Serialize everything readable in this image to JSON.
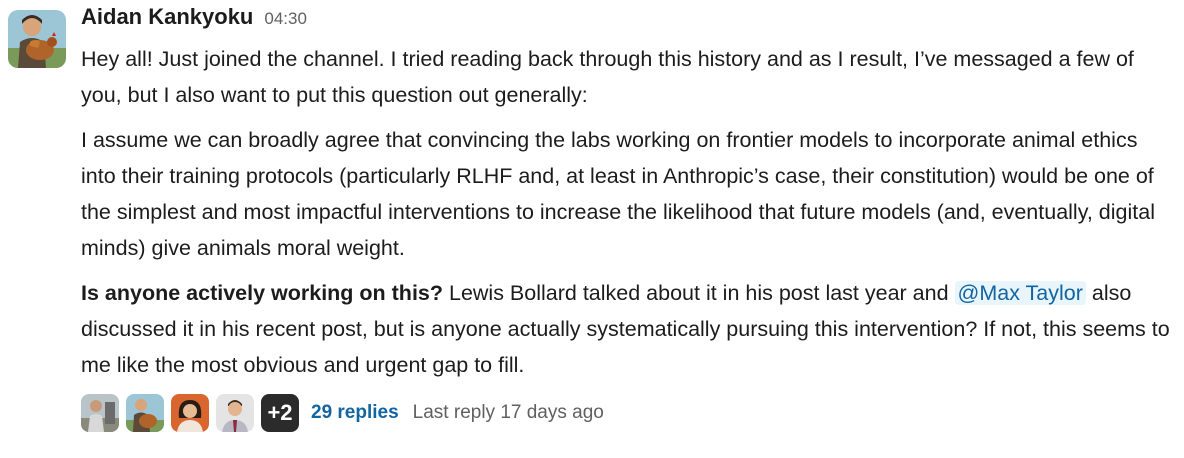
{
  "message": {
    "sender": "Aidan Kankyoku",
    "timestamp": "04:30",
    "p1": "Hey all! Just joined the channel. I tried reading back through this history and as I result, I’ve messaged a few of you, but I also want to put this question out generally:",
    "p2": "I assume we can broadly agree that convincing the labs working on frontier models to incorporate animal ethics into their training protocols (particularly RLHF and, at least in Anthropic’s case, their constitution) would be one of the simplest and most impactful interventions to increase the likelihood that future models (and, eventually, digital minds) give animals moral weight.",
    "p3": {
      "bold": "Is anyone actively working on this?",
      "text1": " Lewis Bollard talked about it in his post last year and ",
      "mention": "@Max Taylor",
      "text2": " also discussed it in his recent post, but is anyone actually systematically pursuing this intervention? If not, this seems to me like the most obvious and urgent gap to fill."
    }
  },
  "thread": {
    "more_count": "+2",
    "replies": "29 replies",
    "last_reply": "Last reply 17 days ago"
  },
  "icons": {
    "sender_avatar": "user-avatar-icon",
    "participant_avatars": [
      "participant-avatar-icon",
      "participant-avatar-icon",
      "participant-avatar-icon",
      "participant-avatar-icon"
    ]
  },
  "colors": {
    "link": "#1264a3",
    "mention_bg": "#e8f5fa",
    "text": "#1d1c1d",
    "muted": "#616061"
  }
}
